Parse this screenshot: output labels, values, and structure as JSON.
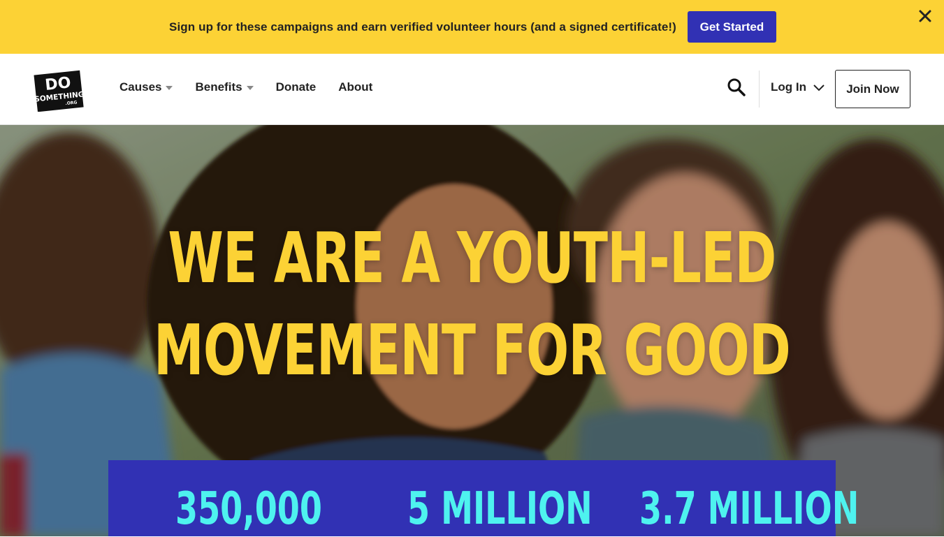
{
  "promo": {
    "text": "Sign up for these campaigns and earn verified volunteer hours (and a signed certificate!)",
    "button_label": "Get Started",
    "close_icon": "close-icon"
  },
  "header": {
    "logo": {
      "line1": "DO",
      "line2": "SOMETHING",
      "line3": ".ORG"
    },
    "nav": [
      {
        "label": "Causes",
        "has_dropdown": true
      },
      {
        "label": "Benefits",
        "has_dropdown": true
      },
      {
        "label": "Donate",
        "has_dropdown": false
      },
      {
        "label": "About",
        "has_dropdown": false
      }
    ],
    "search_icon": "search-icon",
    "login_label": "Log In",
    "join_label": "Join Now"
  },
  "hero": {
    "title_line1": "WE ARE A YOUTH-LED",
    "title_line2": "MOVEMENT FOR GOOD"
  },
  "stats": [
    {
      "value": "350,000"
    },
    {
      "value": "5 MILLION"
    },
    {
      "value": "3.7 MILLION"
    }
  ],
  "colors": {
    "brand_yellow": "#fcd235",
    "brand_blue": "#3131b4",
    "stat_cyan": "#4ef2ef"
  }
}
